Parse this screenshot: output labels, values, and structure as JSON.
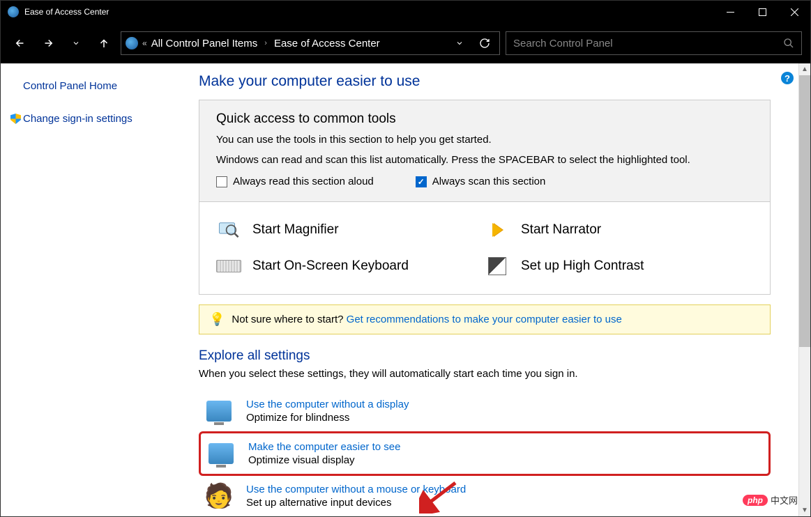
{
  "titlebar": {
    "title": "Ease of Access Center"
  },
  "breadcrumb": {
    "item1": "All Control Panel Items",
    "item2": "Ease of Access Center"
  },
  "search": {
    "placeholder": "Search Control Panel"
  },
  "sidebar": {
    "home": "Control Panel Home",
    "signin": "Change sign-in settings"
  },
  "main": {
    "heading": "Make your computer easier to use",
    "panel": {
      "title": "Quick access to common tools",
      "line1": "You can use the tools in this section to help you get started.",
      "line2": "Windows can read and scan this list automatically.  Press the SPACEBAR to select the highlighted tool.",
      "cb1": "Always read this section aloud",
      "cb2": "Always scan this section"
    },
    "tools": {
      "magnifier": "Start Magnifier",
      "narrator": "Start Narrator",
      "osk": "Start On-Screen Keyboard",
      "contrast": "Set up High Contrast"
    },
    "hint": {
      "lead": "Not sure where to start? ",
      "link": "Get recommendations to make your computer easier to use"
    },
    "explore": {
      "heading": "Explore all settings",
      "desc": "When you select these settings, they will automatically start each time you sign in.",
      "items": [
        {
          "link": "Use the computer without a display",
          "desc": "Optimize for blindness"
        },
        {
          "link": "Make the computer easier to see",
          "desc": "Optimize visual display"
        },
        {
          "link": "Use the computer without a mouse or keyboard",
          "desc": "Set up alternative input devices"
        }
      ]
    }
  },
  "watermark": {
    "badge": "php",
    "text": "中文网"
  }
}
